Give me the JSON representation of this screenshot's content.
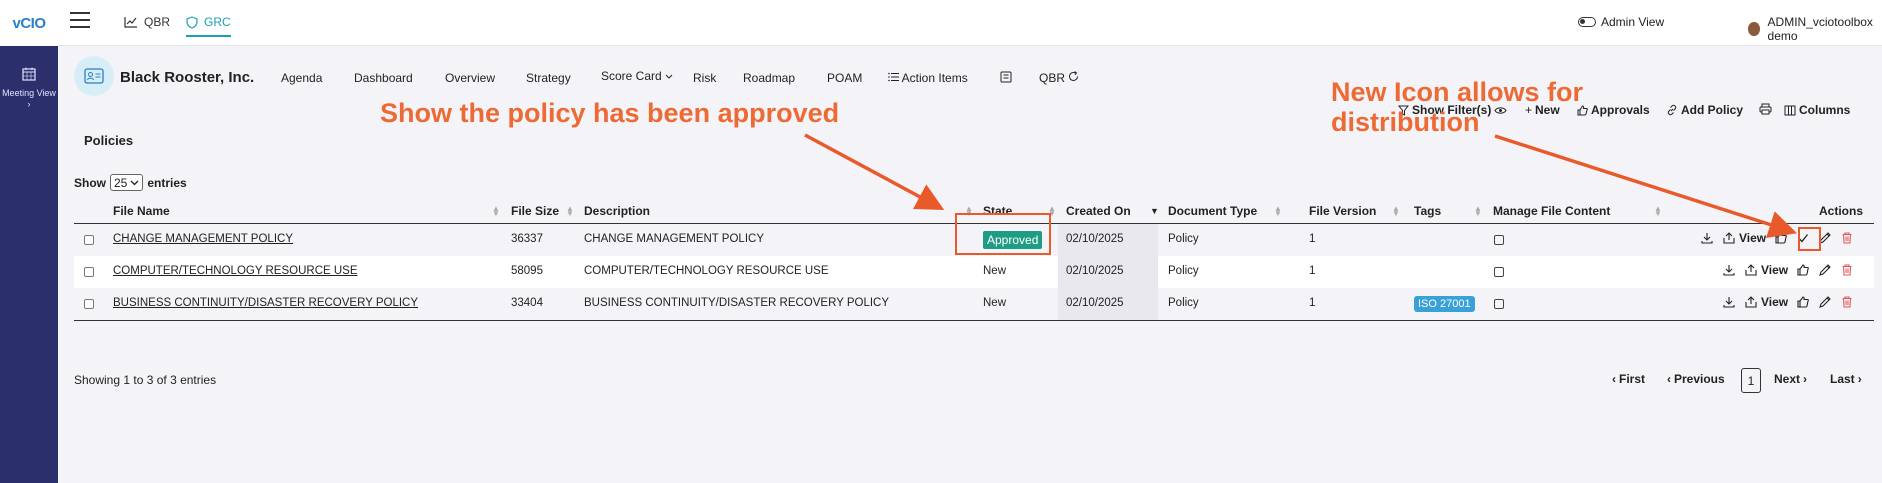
{
  "rail": {
    "logo": "vCIO",
    "meeting_view": "Meeting View",
    "meeting_chevron": "›"
  },
  "topbar": {
    "qbr": "QBR",
    "grc": "GRC",
    "admin_view": "Admin View",
    "user": "ADMIN_vciotoolbox demo"
  },
  "company": {
    "name": "Black Rooster, Inc."
  },
  "subnav": {
    "agenda": "Agenda",
    "dashboard": "Dashboard",
    "overview": "Overview",
    "strategy": "Strategy",
    "score_card": "Score Card",
    "risk": "Risk",
    "roadmap": "Roadmap",
    "poam": "POAM",
    "action_items": "Action Items",
    "qbr": "QBR"
  },
  "page": {
    "title": "Policies"
  },
  "toolbar": {
    "show_filters": "Show Filter(s)",
    "new": "New",
    "approvals": "Approvals",
    "add_policy": "Add Policy",
    "columns": "Columns"
  },
  "entries": {
    "show": "Show",
    "value": "25",
    "suffix": "entries"
  },
  "table": {
    "headers": {
      "file_name": "File Name",
      "file_size": "File Size",
      "description": "Description",
      "state": "State",
      "created_on": "Created On",
      "document_type": "Document Type",
      "file_version": "File Version",
      "tags": "Tags",
      "manage_file_content": "Manage File Content",
      "actions": "Actions"
    },
    "rows": [
      {
        "file_name": "CHANGE MANAGEMENT POLICY",
        "file_size": "36337",
        "description": "CHANGE MANAGEMENT POLICY",
        "state": "Approved",
        "created_on": "02/10/2025",
        "document_type": "Policy",
        "file_version": "1",
        "tag": "",
        "view": "View"
      },
      {
        "file_name": "COMPUTER/TECHNOLOGY RESOURCE USE",
        "file_size": "58095",
        "description": "COMPUTER/TECHNOLOGY RESOURCE USE",
        "state": "New",
        "created_on": "02/10/2025",
        "document_type": "Policy",
        "file_version": "1",
        "tag": "",
        "view": "View"
      },
      {
        "file_name": "BUSINESS CONTINUITY/DISASTER RECOVERY POLICY",
        "file_size": "33404",
        "description": "BUSINESS CONTINUITY/DISASTER RECOVERY POLICY",
        "state": "New",
        "created_on": "02/10/2025",
        "document_type": "Policy",
        "file_version": "1",
        "tag": "ISO 27001",
        "view": "View"
      }
    ]
  },
  "footer": {
    "showing": "Showing 1 to 3 of 3 entries",
    "first": "First",
    "previous": "Previous",
    "page": "1",
    "next": "Next",
    "last": "Last"
  },
  "annotations": {
    "approved_note": "Show the policy has been approved",
    "icon_note_line1": "New Icon allows for",
    "icon_note_line2": "distribution"
  },
  "colors": {
    "rail": "#2b2f6b",
    "accent": "#1a9fb3",
    "approved_badge": "#1e9c84",
    "tag": "#3aa0d8",
    "annotation": "#ee6a35",
    "delete": "#e05a5a"
  }
}
